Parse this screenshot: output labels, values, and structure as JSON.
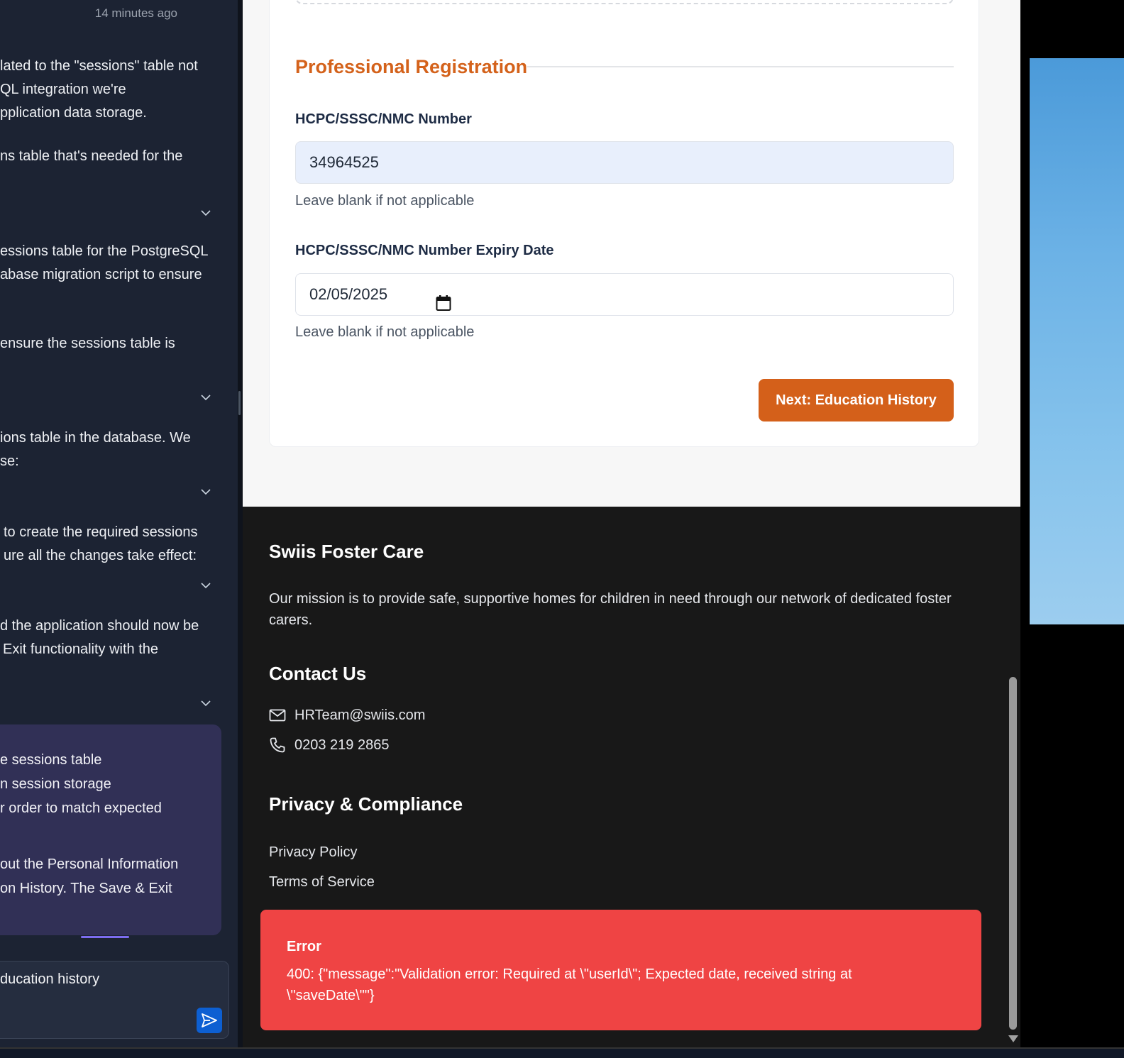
{
  "chat": {
    "timestamp": "14 minutes ago",
    "paragraphs": [
      [
        "lated to the \"sessions\" table not",
        "QL integration we're",
        "pplication data storage."
      ],
      [
        "ns table that's needed for the"
      ],
      [
        "essions table for the PostgreSQL",
        "abase migration script to ensure"
      ],
      [
        "ensure the sessions table is"
      ],
      [
        "ions table in the database. We",
        "se:"
      ],
      [
        "to create the required sessions",
        "ure all the changes take effect:"
      ],
      [
        "d the application should now be",
        "Exit functionality with the"
      ]
    ],
    "card_lines": [
      "e sessions table",
      "n session storage",
      "r order to match expected",
      "out the Personal Information",
      "on History. The Save & Exit"
    ],
    "input_value": "ducation history"
  },
  "form": {
    "section_title": "Professional Registration",
    "reg_number_label": "HCPC/SSSC/NMC Number",
    "reg_number_value": "34964525",
    "reg_number_help": "Leave blank if not applicable",
    "expiry_label": "HCPC/SSSC/NMC Number Expiry Date",
    "expiry_value": "02/05/2025",
    "expiry_help": "Leave blank if not applicable",
    "next_button": "Next: Education History"
  },
  "footer": {
    "brand": "Swiis Foster Care",
    "mission": "Our mission is to provide safe, supportive homes for children in need through our network of dedicated foster carers.",
    "contact_heading": "Contact Us",
    "email": "HRTeam@swiis.com",
    "phone": "0203 219 2865",
    "privacy_heading": "Privacy & Compliance",
    "links": [
      "Privacy Policy",
      "Terms of Service"
    ]
  },
  "toast": {
    "title": "Error",
    "message": "400: {\"message\":\"Validation error: Required at \\\"userId\\\"; Expected date, received string at \\\"saveDate\\\"\"}"
  },
  "colors": {
    "accent": "#d4601a",
    "error": "#ef4444",
    "chat_bg": "#1c2333",
    "footer_bg": "#181818"
  },
  "icons": [
    "chevron-down-icon",
    "send-icon",
    "calendar-icon",
    "mail-icon",
    "phone-icon"
  ]
}
